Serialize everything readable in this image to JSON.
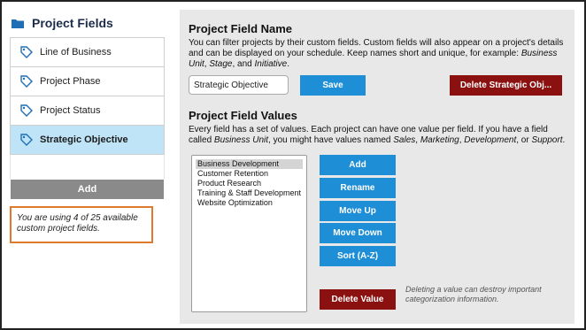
{
  "sidebar": {
    "title": "Project Fields",
    "items": [
      {
        "label": "Line of Business"
      },
      {
        "label": "Project Phase"
      },
      {
        "label": "Project Status"
      },
      {
        "label": "Strategic Objective"
      }
    ],
    "add_label": "Add",
    "notice": "You are using 4 of 25 available custom project fields."
  },
  "name_section": {
    "title": "Project Field Name",
    "description_1": "You can filter projects by their custom fields. Custom fields will also appear on a project's details and can be displayed on your schedule. Keep names short and unique, for example: ",
    "example_1": "Business Unit",
    "sep_1": ", ",
    "example_2": "Stage",
    "sep_2": ", and ",
    "example_3": "Initiative",
    "end": ".",
    "input_value": "Strategic Objective",
    "save_label": "Save",
    "delete_label": "Delete Strategic Obj..."
  },
  "values_section": {
    "title": "Project Field Values",
    "desc_a": "Every field has a set of values. Each project can have one value per field. If you have a field called ",
    "desc_field": "Business Unit",
    "desc_b": ", you might have values named ",
    "desc_v1": "Sales",
    "desc_c": ", ",
    "desc_v2": "Marketing",
    "desc_d": ", ",
    "desc_v3": "Development",
    "desc_e": ", or ",
    "desc_v4": "Support",
    "desc_f": ".",
    "values": [
      "Business Development",
      "Customer Retention",
      "Product Research",
      "Training & Staff Development",
      "Website Optimization"
    ],
    "buttons": {
      "add": "Add",
      "rename": "Rename",
      "move_up": "Move Up",
      "move_down": "Move Down",
      "sort": "Sort (A-Z)",
      "delete": "Delete Value"
    },
    "delete_hint": "Deleting a value can destroy important categorization information."
  },
  "colors": {
    "accent_blue": "#1e8fd6",
    "danger_red": "#8b1010",
    "selected_row": "#bfe3f7",
    "notice_border": "#e07a2c"
  }
}
